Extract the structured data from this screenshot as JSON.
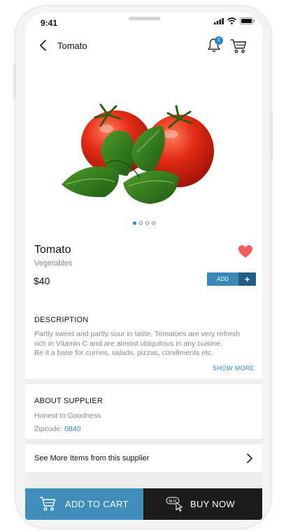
{
  "status_bar": {
    "time": "9:41"
  },
  "header": {
    "title": "Tomato",
    "notification_count": "1"
  },
  "product": {
    "name": "Tomato",
    "category": "Vegetables",
    "price": "$40",
    "add_label": "ADD",
    "add_plus": "+",
    "favorite": true,
    "carousel_dots": 4,
    "carousel_active_index": 0
  },
  "description": {
    "title": "DESCRIPTION",
    "lines": [
      "Partly sweet and partly sour in taste, Tomatoes are very refresh",
      "rich in Vitamin C and are almost ubiquitous in any cuisine.",
      "Be it a base for curries, salads, pizzas, condiments etc."
    ],
    "show_more": "SHOW MORE"
  },
  "supplier": {
    "title": "ABOUT SUPPLIER",
    "name": "Honest to Goodness",
    "zip_label": "Zipcode:",
    "zip_value": "0840"
  },
  "more_items": {
    "label": "See More Items from this supplier"
  },
  "bottom_bar": {
    "add_to_cart": "ADD TO CART",
    "buy_now": "BUY NOW",
    "buy_icon_text": "BUY"
  },
  "colors": {
    "accent": "#3a88b6",
    "accent_dark": "#1f5f86",
    "buy_button": "#1c1c1c",
    "heart": "#f25c5c"
  },
  "icons": {
    "back": "chevron-left-icon",
    "notification": "bell-icon",
    "cart": "shopping-cart-icon",
    "favorite": "heart-icon",
    "more": "chevron-right-icon",
    "buy": "buy-cursor-icon"
  }
}
